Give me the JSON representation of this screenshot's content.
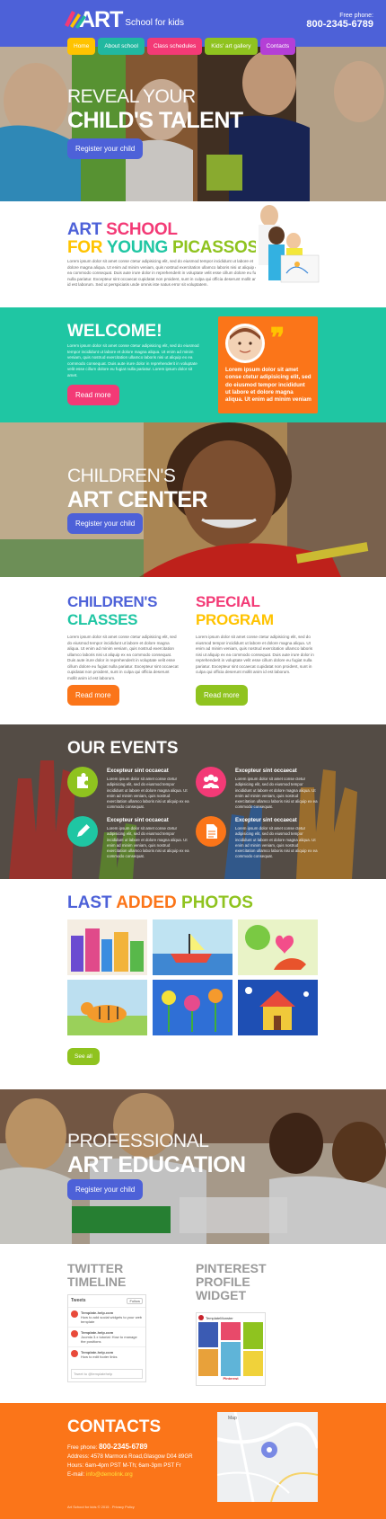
{
  "header": {
    "logo_text": "ART",
    "logo_sub": "School for kids",
    "phone_label": "Free phone:",
    "phone_number": "800-2345-6789"
  },
  "nav": [
    {
      "label": "Home",
      "color": "#ffc300"
    },
    {
      "label": "About school",
      "color": "#21b8a0"
    },
    {
      "label": "Class schedules",
      "color": "#f33a76"
    },
    {
      "label": "Kids' art gallery",
      "color": "#8fc31f"
    },
    {
      "label": "Contacts",
      "color": "#b43fd6"
    }
  ],
  "hero": {
    "line1": "REVEAL YOUR",
    "line2": "CHILD'S TALENT",
    "cta": "Register your child"
  },
  "art_school": {
    "w1": "ART",
    "w2": "SCHOOL",
    "w3": "FOR",
    "w4": "YOUNG",
    "w5": "PICASSOS",
    "text": "Lorem ipsum dolor sit amet conse ctetur adipisicing elit, sed do eiusmod tempor incididunt ut labore et dolore magna aliqua. Ut enim ad minim veniam, quis nostrud exercitation ullamco laboris nisi ut aliquip ex ea commodo consequat. Duis aute irure dolor in reprehenderit in voluptate velit esse cillum dolore eu fugiat nulla pariatur. Excepteur sint occaecat cupidatat non proident, sunt in culpa qui officia deserunt mollit anim id est laborum. Sed ut perspiciatis unde omnis iste natus error sit voluptatem."
  },
  "welcome": {
    "title": "WELCOME!",
    "text": "Lorem ipsum dolor sit amet conse ctetur adipisicing elit, sed do eiusmod tempor incididunt ut labore et dolore magna aliqua. Ut enim ad minim veniam, quis nostrud exercitation ullamco laboris nisi ut aliquip ex ea commodo consequat. Duis aute irure dolor in reprehenderit in voluptate velit esse cillum dolore eu fugiat nulla pariatur. Lorem ipsum dolor sit amet.",
    "button": "Read more",
    "quote": "Lorem ipsum dolor sit amet conse ctetur adipisicing elit, sed do eiusmod tempor incididunt ut labore et dolore magna aliqua. Ut enim ad minim veniam"
  },
  "art_center": {
    "line1": "CHILDREN'S",
    "line2": "ART CENTER",
    "cta": "Register your child"
  },
  "classes": {
    "title1": "CHILDREN'S",
    "title2": "CLASSES",
    "text": "Lorem ipsum dolor sit amet conse ctetur adipisicing elit, sed do eiusmod tempor incididunt ut labore et dolore magna aliqua. Ut enim ad minim veniam, quis nostrud exercitation ullamco laboris nisi ut aliquip ex ea commodo consequat. Duis aute irure dolor in reprehenderit in voluptate velit esse cillum dolore eu fugiat nulla pariatur. Excepteur sint occaecat cupidatat non proident, sunt in culpa qui officia deserunt mollit anim id est laborum.",
    "button": "Read more"
  },
  "program": {
    "title1": "SPECIAL",
    "title2": "PROGRAM",
    "text": "Lorem ipsum dolor sit amet conse ctetur adipisicing elit, sed do eiusmod tempor incididunt ut labore et dolore magna aliqua. Ut enim ad minim veniam, quis nostrud exercitation ullamco laboris nisi ut aliquip ex ea commodo consequat. Duis aute irure dolor in reprehenderit in voluptate velit esse cillum dolore eu fugiat nulla pariatur. Excepteur sint occaecat cupidatat non proident, sunt in culpa qui officia deserunt mollit anim id est laborum.",
    "button": "Read more"
  },
  "events": {
    "title": "OUR EVENTS",
    "items": [
      {
        "icon": "puzzle-icon",
        "color": "#8fc31f",
        "title": "Excepteur sint occaecat",
        "text": "Lorem ipsum dolor sit amet conse ctetur adipisicing elit, sed do eiusmod tempor incididunt ut labore et dolore magna aliqua. Ut enim ad minim veniam, quis nostrud exercitation ullamco laboris nisi ut aliquip ex ea commodo consequat."
      },
      {
        "icon": "group-icon",
        "color": "#f33a76",
        "title": "Excepteur sint occaecat",
        "text": "Lorem ipsum dolor sit amet conse ctetur adipisicing elit, sed do eiusmod tempor incididunt ut labore et dolore magna aliqua. Ut enim ad minim veniam, quis nostrud exercitation ullamco laboris nisi ut aliquip ex ea commodo consequat."
      },
      {
        "icon": "pencil-icon",
        "color": "#1fc6a3",
        "title": "Excepteur sint occaecat",
        "text": "Lorem ipsum dolor sit amet conse ctetur adipisicing elit, sed do eiusmod tempor incididunt ut labore et dolore magna aliqua. Ut enim ad minim veniam, quis nostrud exercitation ullamco laboris nisi ut aliquip ex ea commodo consequat."
      },
      {
        "icon": "document-icon",
        "color": "#fb7519",
        "title": "Excepteur sint occaecat",
        "text": "Lorem ipsum dolor sit amet conse ctetur adipisicing elit, sed do eiusmod tempor incididunt ut labore et dolore magna aliqua. Ut enim ad minim veniam, quis nostrud exercitation ullamco laboris nisi ut aliquip ex ea commodo consequat."
      }
    ]
  },
  "photos": {
    "w1": "LAST",
    "w2": "ADDED",
    "w3": "PHOTOS",
    "button": "See all"
  },
  "education": {
    "line1": "PROFESSIONAL",
    "line2": "ART EDUCATION",
    "cta": "Register your child"
  },
  "widgets": {
    "twitter_title1": "TWITTER",
    "twitter_title2": "TIMELINE",
    "tweets_label": "Tweets",
    "follow": "Follow",
    "tweets": [
      {
        "user": "Template-help.com",
        "text": "How to add social widgets to your web template"
      },
      {
        "user": "Template-help.com",
        "text": "Joomla 3.x tutorial: How to manage the positions"
      },
      {
        "user": "Template-help.com",
        "text": "How to edit footer links"
      }
    ],
    "tweet_box": "Tweet to @templatehelp",
    "pinterest_title1": "PINTEREST",
    "pinterest_title2": "PROFILE",
    "pinterest_title3": "WIDGET",
    "pin_user": "TemplateMonster",
    "pin_footer": "Pinterest"
  },
  "contacts": {
    "title": "CONTACTS",
    "phone_label": "Free phone:",
    "phone": "800-2345-6789",
    "address_label": "Address:",
    "address": "4578 Marmora Road,Glasgow D04 89GR",
    "hours_label": "Hours:",
    "hours": "6am-4pm PST M-Th;  6am-3pm PST Fr",
    "email_label": "E-mail:",
    "email": "info@demolink.org",
    "footer": "Art School for kids © 2015 . Privacy Policy",
    "map_label": "Map"
  }
}
